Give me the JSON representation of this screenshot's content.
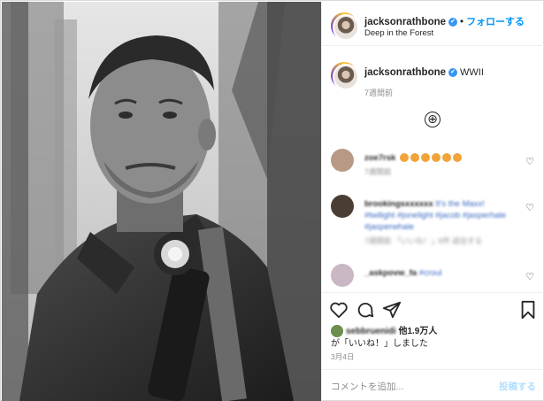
{
  "post": {
    "username": "jacksonrathbone",
    "verified_mark": "✔",
    "separator": "•",
    "follow_label": "フォローする",
    "location": "Deep in the Forest"
  },
  "caption": {
    "username": "jacksonrathbone",
    "text": "WWII",
    "time": "7週間前"
  },
  "load_more_icon": "⊕",
  "comments": [
    {
      "user": "zoe7rsk",
      "text": "",
      "meta": "7週間前",
      "avatar_color": "#b79a86"
    },
    {
      "user": "brookingsxxxxxx",
      "text": "It's the Maxx! #twilight #jonelight #jacob #jasperhale #jasperwhale",
      "meta": "7週間前   「いいね！」6件   返信する",
      "avatar_color": "#4a3e34"
    },
    {
      "user": "_askpovw_fa",
      "text": "#croul",
      "meta": "",
      "avatar_color": "#c9b7c3"
    }
  ],
  "actions": {
    "like_icon": "heart-outline",
    "comment_icon": "speech-bubble",
    "share_icon": "paper-plane",
    "save_icon": "bookmark"
  },
  "likes": {
    "liker": "sebbruenidi",
    "others_label": "他1.9万人",
    "line2": "が「いいね！」しました"
  },
  "date": "3月4日",
  "add_comment": {
    "placeholder": "コメントを追加...",
    "post_label": "投稿する"
  },
  "colors": {
    "link_blue": "#0095f6",
    "verified_blue": "#3897f0",
    "muted": "#8e8e8e",
    "post_disabled": "#b2dffc"
  }
}
